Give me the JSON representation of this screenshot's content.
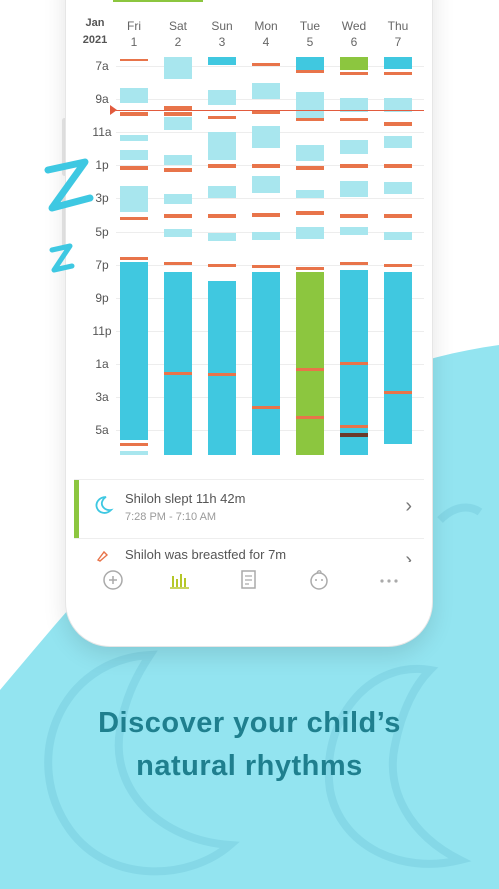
{
  "header": {
    "month": "Jan",
    "year": "2021"
  },
  "days": [
    {
      "name": "Fri",
      "num": "1"
    },
    {
      "name": "Sat",
      "num": "2"
    },
    {
      "name": "Sun",
      "num": "3"
    },
    {
      "name": "Mon",
      "num": "4"
    },
    {
      "name": "Tue",
      "num": "5"
    },
    {
      "name": "Wed",
      "num": "6"
    },
    {
      "name": "Thu",
      "num": "7"
    }
  ],
  "time_labels": [
    "7a",
    "9a",
    "11a",
    "1p",
    "3p",
    "5p",
    "7p",
    "9p",
    "11p",
    "1a",
    "3a",
    "5a"
  ],
  "events": [
    {
      "title": "Shiloh slept 11h 42m",
      "subtitle": "7:28 PM - 7:10 AM",
      "icon": "moon-icon"
    },
    {
      "title": "Shiloh was breastfed for 7m",
      "subtitle": "",
      "icon": "bottle-icon"
    }
  ],
  "tabs": [
    "plus-circle-icon",
    "bar-chart-icon",
    "notes-icon",
    "baby-face-icon",
    "more-icon"
  ],
  "headline": {
    "line1": "Discover your child’s",
    "line2": "natural rhythms"
  },
  "colors": {
    "night_sleep": "#40c8e0",
    "nap": "#a8e6ee",
    "feed": "#e8744a",
    "highlight": "#8cc63f",
    "headline": "#1f7f8e"
  }
}
